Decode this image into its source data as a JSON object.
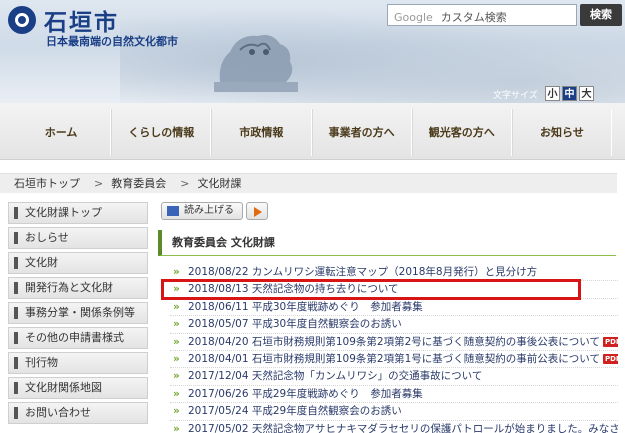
{
  "header": {
    "title": "石垣市",
    "subtitle": "日本最南端の自然文化都市",
    "search_brand": "Google",
    "search_placeholder": "カスタム検索",
    "search_button": "検索",
    "font_size_label": "文字サイズ",
    "font_small": "小",
    "font_mid": "中",
    "font_big": "大"
  },
  "nav": {
    "items": [
      "ホーム",
      "くらしの情報",
      "市政情報",
      "事業者の方へ",
      "観光客の方へ",
      "お知らせ"
    ]
  },
  "breadcrumb": {
    "items": [
      "石垣市トップ",
      "教育委員会",
      "文化財課"
    ],
    "separator": ">"
  },
  "sidebar": {
    "items": [
      "文化財課トップ",
      "おしらせ",
      "文化財",
      "開発行為と文化財",
      "事務分掌・関係条例等",
      "その他の申請書様式",
      "刊行物",
      "文化財関係地図",
      "お問い合わせ"
    ]
  },
  "main": {
    "tts_label": "読み上げる",
    "heading": "教育委員会  文化財課",
    "news": [
      {
        "date": "2018/08/22",
        "text": "カンムリワシ運転注意マップ（2018年8月発行）と見分け方",
        "pdf": ""
      },
      {
        "date": "2018/08/13",
        "text": "天然記念物の持ち去りについて",
        "pdf": ""
      },
      {
        "date": "2018/06/11",
        "text": "平成30年度戦跡めぐり　参加者募集",
        "pdf": ""
      },
      {
        "date": "2018/05/07",
        "text": "平成30年度自然観察会のお誘い",
        "pdf": ""
      },
      {
        "date": "2018/04/20",
        "text": "石垣市財務規則第109条第2項第2号に基づく随意契約の事後公表について",
        "pdf": "PDF"
      },
      {
        "date": "2018/04/01",
        "text": "石垣市財務規則第109条第2項第1号に基づく随意契約の事前公表について",
        "pdf": "PDF"
      },
      {
        "date": "2017/12/04",
        "text": "天然記念物「カンムリワシ」の交通事故について",
        "pdf": ""
      },
      {
        "date": "2017/06/26",
        "text": "平成29年度戦跡めぐり　参加者募集",
        "pdf": ""
      },
      {
        "date": "2017/05/24",
        "text": "平成29年度自然観察会のお誘い",
        "pdf": ""
      },
      {
        "date": "2017/05/02",
        "text": "天然記念物アサヒナキマダラセセリの保護パトロールが始まりました。みなさまのご",
        "pdf": ""
      }
    ]
  },
  "colors": {
    "brand": "#1a3f86",
    "accent_green": "#77a832",
    "highlight": "#d81414"
  }
}
